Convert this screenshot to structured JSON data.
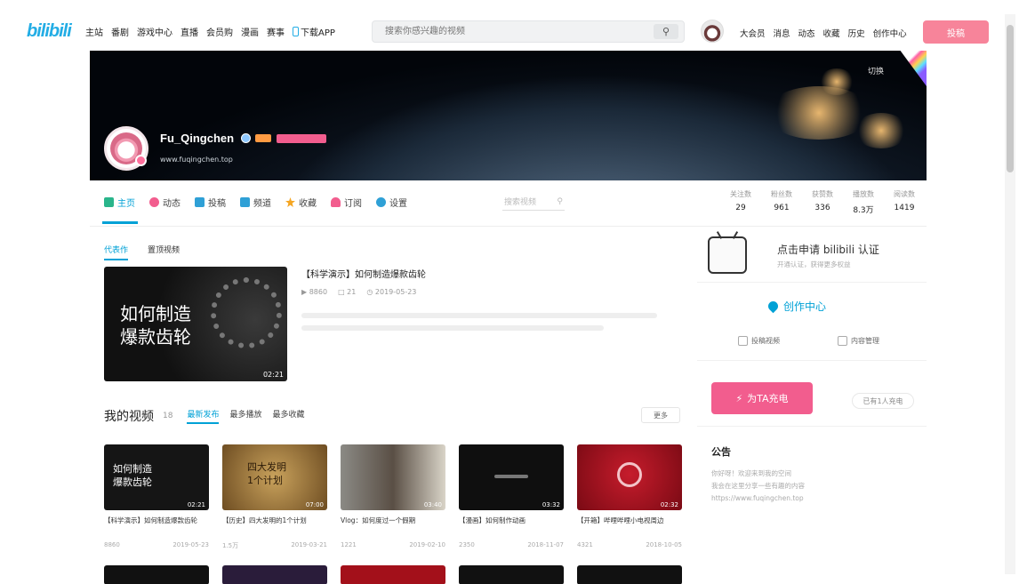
{
  "topbar": {
    "logo": "bilibili",
    "nav": [
      "主站",
      "番剧",
      "游戏中心",
      "直播",
      "会员购",
      "漫画",
      "赛事"
    ],
    "app_label": "下载APP",
    "search_placeholder": "搜索你感兴趣的视频",
    "right_links": [
      "大会员",
      "消息",
      "动态",
      "收藏",
      "历史",
      "创作中心"
    ],
    "upload_label": "投稿"
  },
  "banner": {
    "switch_label": "切换",
    "username": "Fu_Qingchen",
    "sign": "www.fuqingchen.top"
  },
  "tabs": [
    {
      "label": "主页",
      "count": "",
      "color": "#2ab58b"
    },
    {
      "label": "动态",
      "count": "",
      "color": "#f25d8e"
    },
    {
      "label": "投稿",
      "count": "",
      "color": "#2fa0d6"
    },
    {
      "label": "频道",
      "count": "",
      "color": "#2fa0d6"
    },
    {
      "label": "收藏",
      "count": "",
      "color": "#f5a623"
    },
    {
      "label": "订阅",
      "count": "",
      "color": "#f25d8e"
    },
    {
      "label": "设置",
      "count": "",
      "color": "#2fa0d6"
    }
  ],
  "tab_search_placeholder": "搜索视频",
  "stats": [
    {
      "k": "关注数",
      "v": "29"
    },
    {
      "k": "粉丝数",
      "v": "961"
    },
    {
      "k": "获赞数",
      "v": "336"
    },
    {
      "k": "播放数",
      "v": "8.3万"
    },
    {
      "k": "阅读数",
      "v": "1419"
    }
  ],
  "representative": {
    "tabs": [
      "代表作",
      "置顶视频"
    ],
    "thumb_text_1": "如何制造",
    "thumb_text_2": "爆款齿轮",
    "duration": "02:21",
    "title": "【科学演示】如何制造爆款齿轮",
    "plays": "8860",
    "comments": "21",
    "date": "2019-05-23"
  },
  "videos_section": {
    "heading": "我的视频",
    "count": "18",
    "sort": [
      "最新发布",
      "最多播放",
      "最多收藏"
    ],
    "more": "更多"
  },
  "videos": [
    {
      "thumb_text": "如何制造\n爆款齿轮",
      "duration": "02:21",
      "title": "【科学演示】如何制造爆款齿轮",
      "plays": "8860",
      "date": "2019-05-23",
      "bg": "#151515"
    },
    {
      "thumb_text": "四大发明\n1个计划",
      "duration": "07:00",
      "title": "【历史】四大发明的1个计划",
      "plays": "1.5万",
      "date": "2019-03-21",
      "bg": "#8a6a36"
    },
    {
      "thumb_text": "",
      "duration": "03:40",
      "title": "Vlog：如何度过一个假期",
      "plays": "1221",
      "date": "2019-02-10",
      "bg": "#6b6258"
    },
    {
      "thumb_text": "",
      "duration": "03:32",
      "title": "【漫画】如何制作动画",
      "plays": "2350",
      "date": "2018-11-07",
      "bg": "#0f0f0f"
    },
    {
      "thumb_text": "",
      "duration": "02:32",
      "title": "【开箱】哔哩哔哩小电视周边",
      "plays": "4321",
      "date": "2018-10-05",
      "bg": "#a30f1e"
    }
  ],
  "side": {
    "auth_title": "点击申请 bilibili 认证",
    "auth_sub": "开通认证，获得更多权益",
    "creator_title": "创作中心",
    "creator_links": [
      "投稿视频",
      "内容管理"
    ],
    "charge_label": "为TA充电",
    "charge_note": "已有1人充电",
    "notice_title": "公告",
    "notice_text": "你好呀！欢迎来到我的空间\n我会在这里分享一些有趣的内容\nhttps://www.fuqingchen.top"
  }
}
